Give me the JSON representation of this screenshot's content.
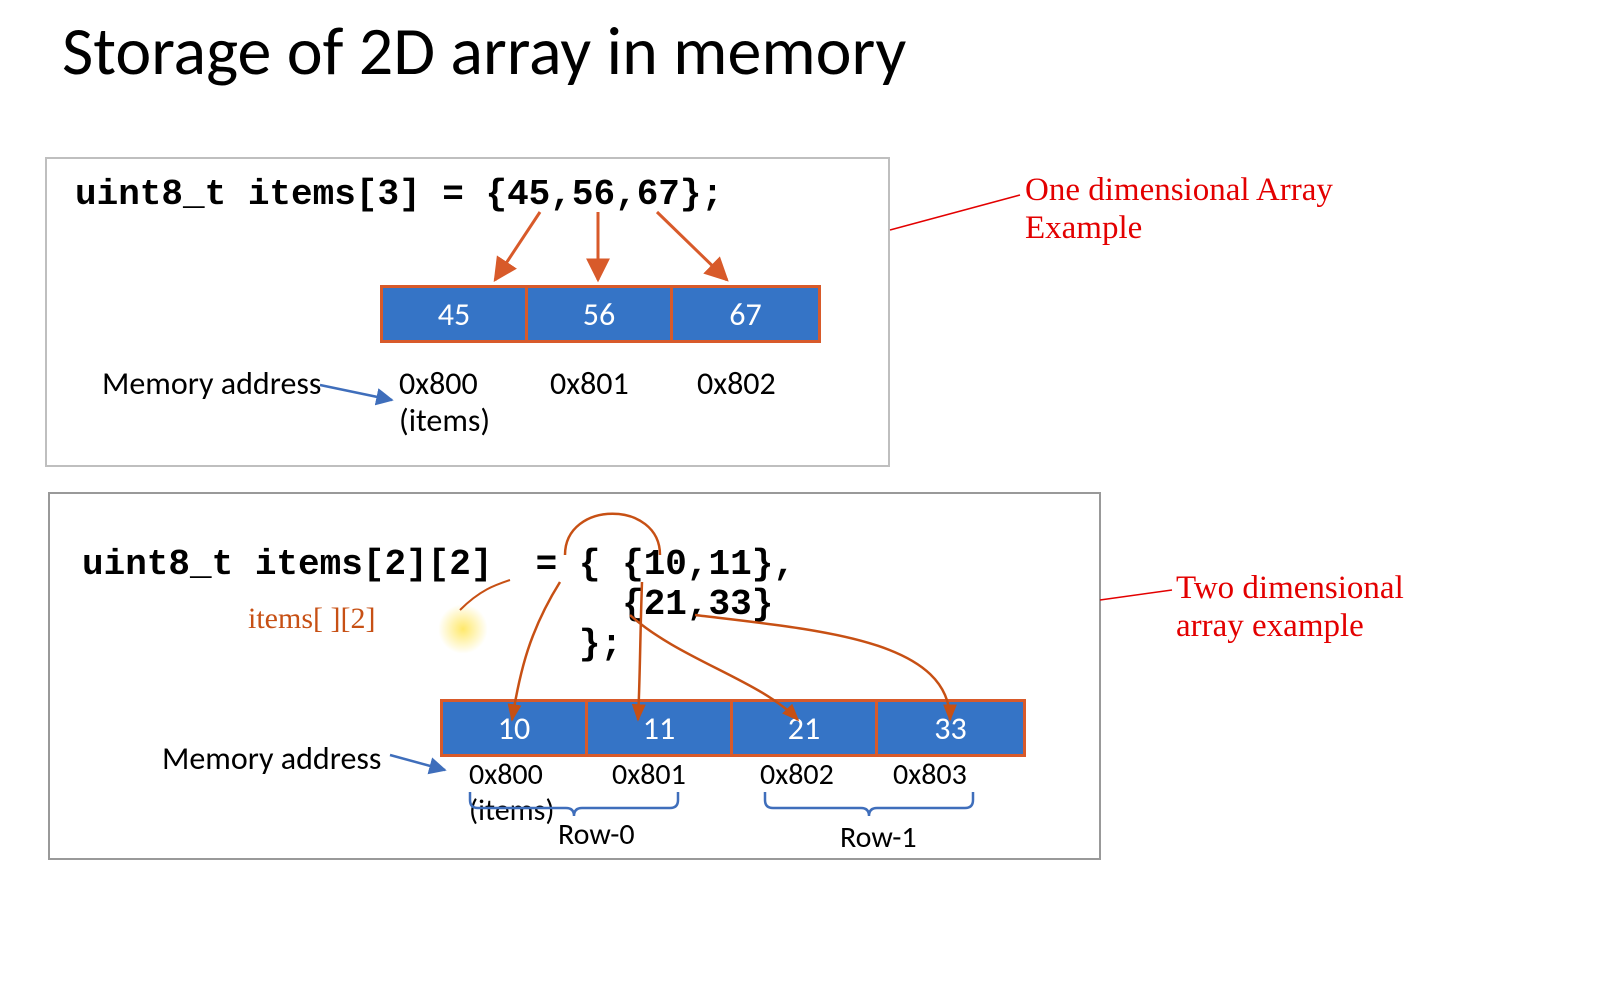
{
  "title": "Storage of 2D array in memory",
  "panel1": {
    "code": "uint8_t items[3] = {45,56,67};",
    "cells": [
      "45",
      "56",
      "67"
    ],
    "mem_label": "Memory address",
    "addrs": [
      "0x800",
      "0x801",
      "0x802"
    ],
    "items_label": "(items)"
  },
  "panel2": {
    "code_l1": "uint8_t items[2][2]  = { {10,11},",
    "code_l2": "                         {21,33}",
    "code_l3": "                       };",
    "handwritten": "items[ ][2]",
    "cells": [
      "10",
      "11",
      "21",
      "33"
    ],
    "mem_label": "Memory address",
    "addrs": [
      "0x800",
      "0x801",
      "0x802",
      "0x803"
    ],
    "items_label": "(items)",
    "row0": "Row-0",
    "row1": "Row-1"
  },
  "callout1": "One dimensional Array\nExample",
  "callout2": "Two dimensional\narray example"
}
